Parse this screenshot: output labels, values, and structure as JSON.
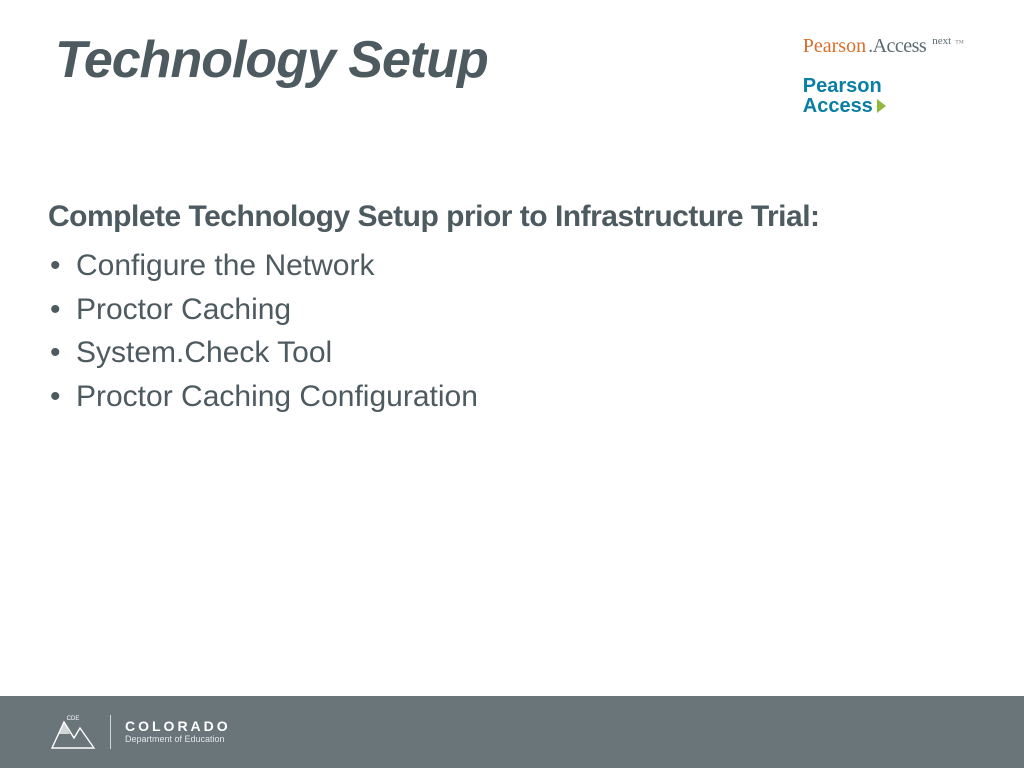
{
  "title": "Technology Setup",
  "logos": {
    "pan_pearson": "Pearson",
    "pan_access": ".Access",
    "pan_next": "next",
    "pan_tm": "™",
    "pa2_line1": "Pearson",
    "pa2_access": "Access"
  },
  "content": {
    "subtitle": "Complete Technology Setup prior to Infrastructure Trial:",
    "bullets": [
      "Configure the Network",
      "Proctor Caching",
      "System.Check Tool",
      "Proctor Caching Configuration"
    ]
  },
  "footer": {
    "badge_label": "CDE",
    "colorado": "COLORADO",
    "dept": "Department of Education"
  }
}
